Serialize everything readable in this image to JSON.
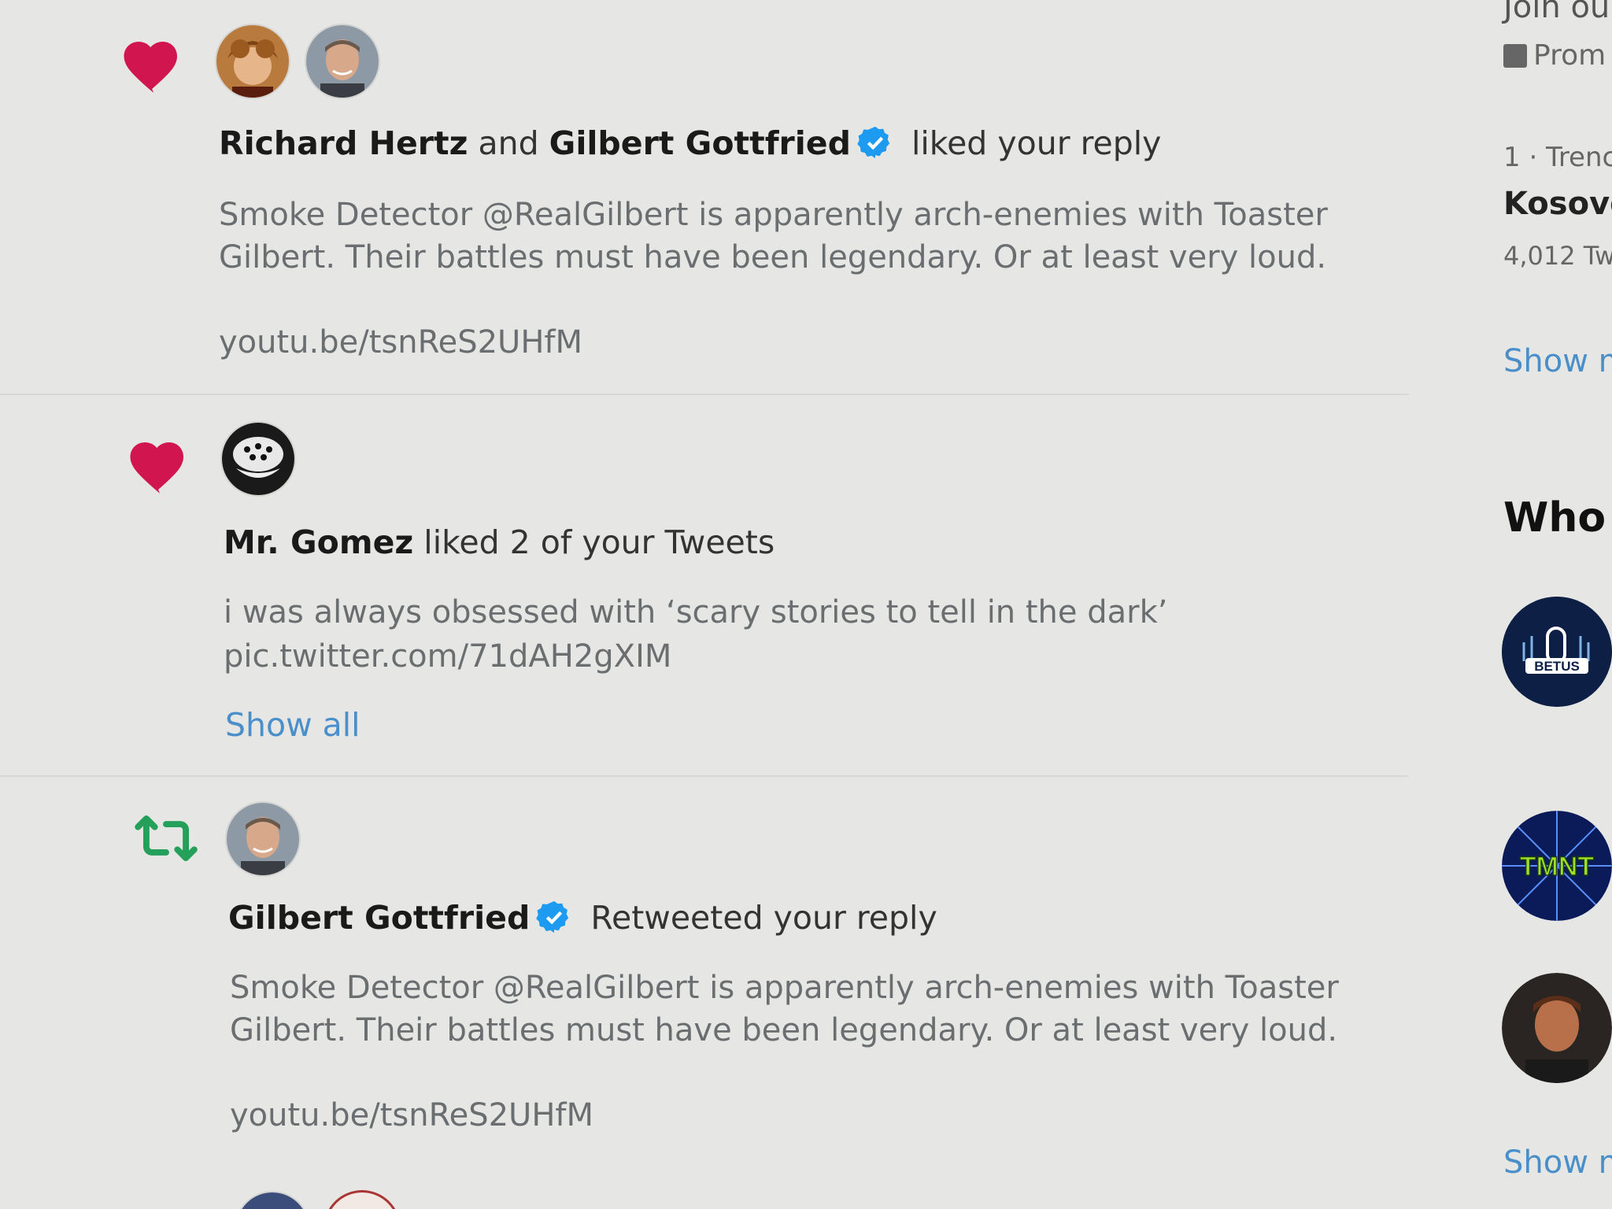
{
  "notifications": [
    {
      "type": "like",
      "icon": "heart-icon",
      "actor1": "Richard Hertz",
      "joiner": "and",
      "actor2": "Gilbert Gottfried",
      "action": "liked your reply",
      "text": "Smoke Detector @RealGilbert is apparently arch-enemies with Toaster Gilbert. Their battles must have been legendary. Or at least very loud.",
      "link": "youtu.be/tsnReS2UHfM"
    },
    {
      "type": "like",
      "icon": "heart-icon",
      "actor1": "Mr. Gomez",
      "action": "liked 2 of your Tweets",
      "text": "i was always obsessed with ‘scary stories to tell in the dark’",
      "link": "pic.twitter.com/71dAH2gXIM",
      "show_all": "Show all"
    },
    {
      "type": "retweet",
      "icon": "retweet-icon",
      "actor1": "Gilbert Gottfried",
      "action": "Retweeted your reply",
      "text": "Smoke Detector @RealGilbert is apparently arch-enemies with Toaster Gilbert. Their battles must have been legendary. Or at least very loud.",
      "link": "youtu.be/tsnReS2UHfM"
    }
  ],
  "sidebar": {
    "join_partial": "Join ou",
    "promoted_partial": "Prom",
    "trend_rank": "1 · Trenc",
    "trend_name": "Kosovo",
    "trend_count": "4,012 Tw",
    "show_more_1": "Show m",
    "who_heading": "Who",
    "show_more_2": "Show m",
    "badge_betus": "BETUS",
    "badge_tmnt": "TMNT"
  },
  "colors": {
    "like_red": "#d1154f",
    "retweet_green": "#25a05a",
    "verified_blue": "#1d9bf0",
    "link_blue": "#4a8fc9"
  }
}
